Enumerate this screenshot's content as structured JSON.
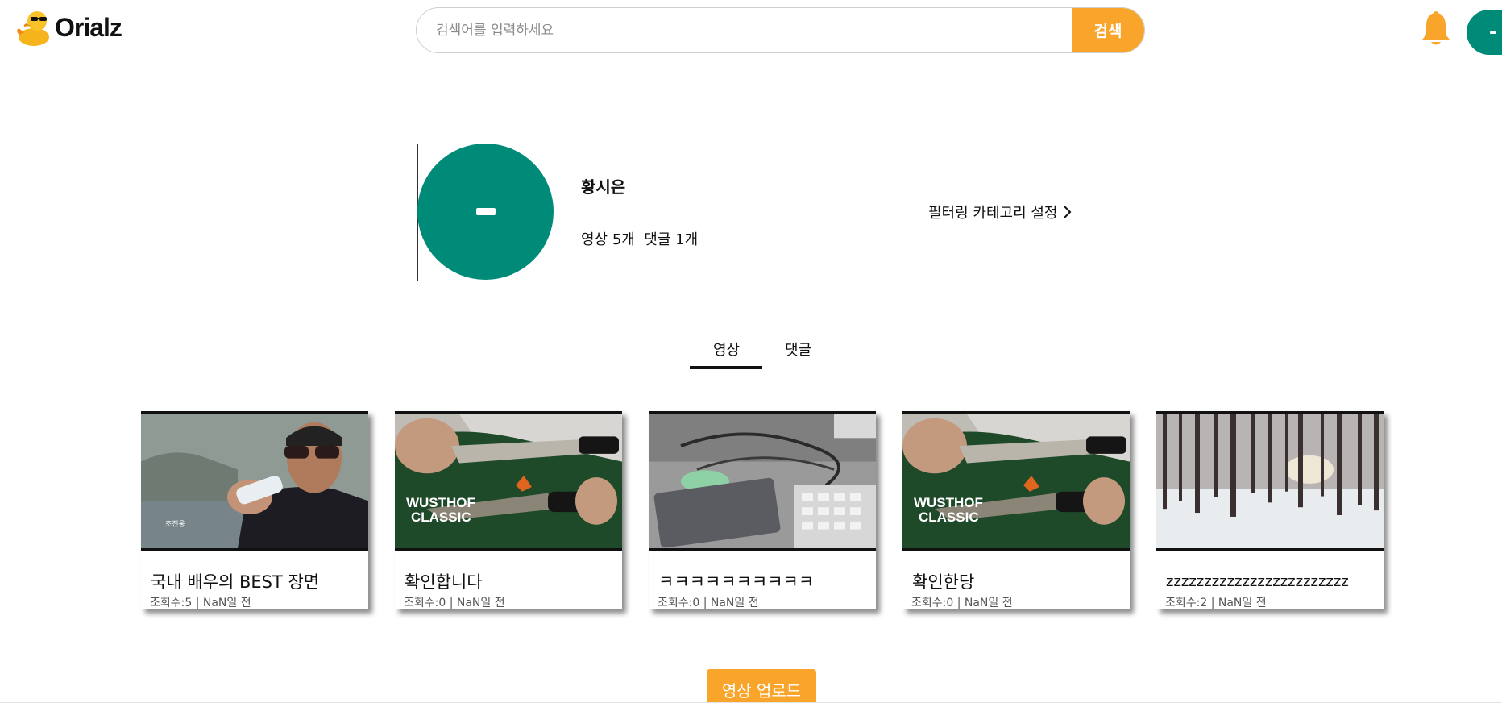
{
  "app": {
    "logo_text": "Orialz"
  },
  "search": {
    "placeholder": "검색어를 입력하세요",
    "button_label": "검색"
  },
  "header": {
    "avatar_initial": "-"
  },
  "profile": {
    "name": "황시은",
    "stats": "영상 5개  댓글 1개",
    "filter_link": "필터링 카테고리 설정"
  },
  "tabs": [
    {
      "label": "영상",
      "active": true
    },
    {
      "label": "댓글",
      "active": false
    }
  ],
  "videos": [
    {
      "title": "국내 배우의 BEST 장면",
      "meta": "조회수:5 | NaN일 전",
      "thumb": "man-sunglasses-drinking"
    },
    {
      "title": "확인합니다",
      "meta": "조회수:0 | NaN일 전",
      "thumb": "knife-wusthof-classic"
    },
    {
      "title": "ㅋㅋㅋㅋㅋㅋㅋㅋㅋㅋ",
      "meta": "조회수:0 | NaN일 전",
      "thumb": "desk-cables-laptop"
    },
    {
      "title": "확인한당",
      "meta": "조회수:0 | NaN일 전",
      "thumb": "knife-wusthof-classic"
    },
    {
      "title": "zzzzzzzzzzzzzzzzzzzzzzzz",
      "meta": "조회수:2 | NaN일 전",
      "thumb": "snowy-forest"
    }
  ],
  "thumb_text": {
    "wusthof_line1": "WUSTHOF",
    "wusthof_line2": "CLASSIC"
  },
  "upload": {
    "button_label": "영상 업로드"
  },
  "colors": {
    "accent": "#f9a52b",
    "avatar": "#008a78"
  }
}
